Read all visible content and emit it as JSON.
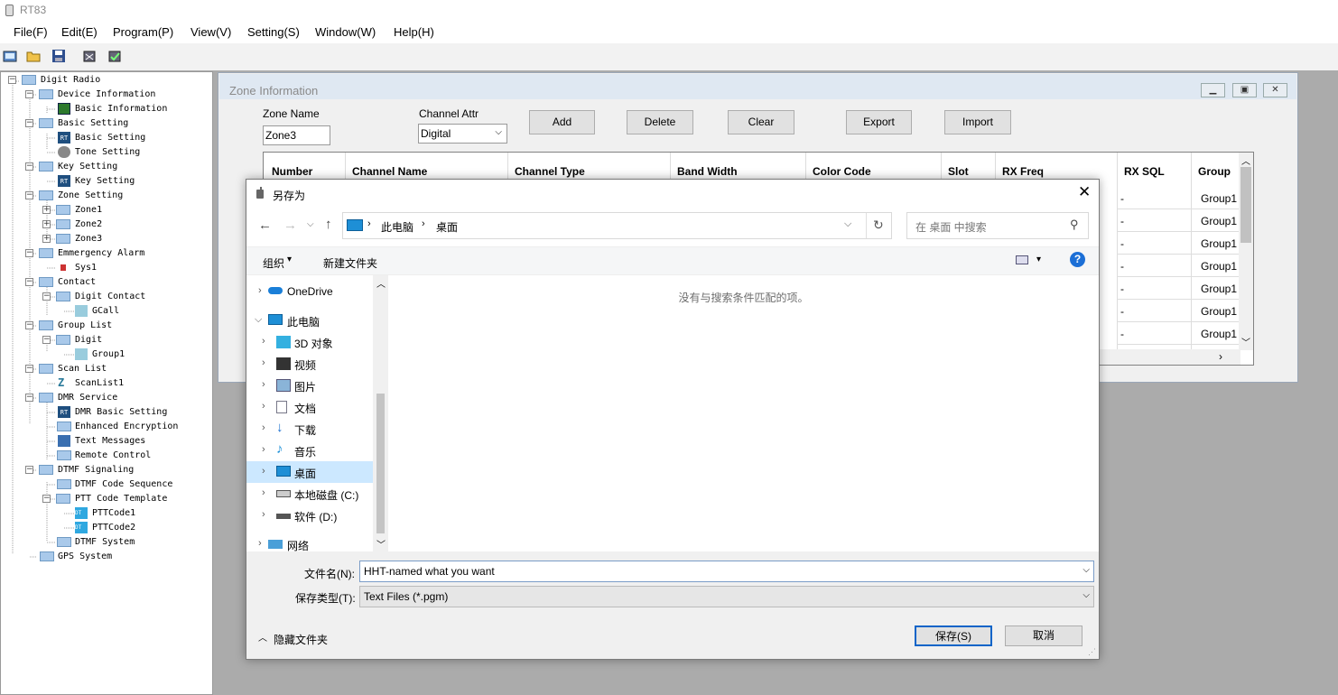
{
  "app": {
    "title": "RT83"
  },
  "menu": [
    "File(F)",
    "Edit(E)",
    "Program(P)",
    "View(V)",
    "Setting(S)",
    "Window(W)",
    "Help(H)"
  ],
  "tree": [
    "Digit Radio",
    "Device Information",
    "Basic Information",
    "Basic Setting",
    "Basic Setting",
    "Tone Setting",
    "Key Setting",
    "Key Setting",
    "Zone Setting",
    "Zone1",
    "Zone2",
    "Zone3",
    "Emmergency Alarm",
    "Sys1",
    "Contact",
    "Digit Contact",
    "GCall",
    "Group List",
    "Digit",
    "Group1",
    "Scan List",
    "ScanList1",
    "DMR Service",
    "DMR Basic Setting",
    "Enhanced Encryption",
    "Text Messages",
    "Remote Control",
    "DTMF Signaling",
    "DTMF Code Sequence",
    "PTT Code Template",
    "PTTCode1",
    "PTTCode2",
    "DTMF System",
    "GPS System"
  ],
  "zone": {
    "title": "Zone Information",
    "zone_name_label": "Zone Name",
    "zone_name_value": "Zone3",
    "channel_attr_label": "Channel Attr",
    "channel_attr_value": "Digital",
    "buttons": {
      "add": "Add",
      "delete": "Delete",
      "clear": "Clear",
      "export": "Export",
      "import": "Import"
    },
    "columns": [
      "Number",
      "Channel Name",
      "Channel Type",
      "Band Width",
      "Color Code",
      "Slot",
      "RX Freq",
      "RX SQL",
      "Group"
    ],
    "rows": [
      {
        "rx_sql": "-",
        "group": "Group1"
      },
      {
        "rx_sql": "-",
        "group": "Group1"
      },
      {
        "rx_sql": "-",
        "group": "Group1"
      },
      {
        "rx_sql": "-",
        "group": "Group1"
      },
      {
        "rx_sql": "-",
        "group": "Group1"
      },
      {
        "rx_sql": "-",
        "group": "Group1"
      },
      {
        "rx_sql": "-",
        "group": "Group1"
      }
    ]
  },
  "dialog": {
    "title": "另存为",
    "breadcrumb": [
      "此电脑",
      "桌面"
    ],
    "search_placeholder": "在 桌面 中搜索",
    "organize": "组织",
    "new_folder": "新建文件夹",
    "empty_message": "没有与搜索条件匹配的项。",
    "nav": [
      "OneDrive",
      "此电脑",
      "3D 对象",
      "视频",
      "图片",
      "文档",
      "下载",
      "音乐",
      "桌面",
      "本地磁盘 (C:)",
      "软件 (D:)",
      "网络"
    ],
    "filename_label": "文件名(N):",
    "filename_value": "HHT-named what you want",
    "filetype_label": "保存类型(T):",
    "filetype_value": "Text Files (*.pgm)",
    "hide_folders": "隐藏文件夹",
    "save": "保存(S)",
    "cancel": "取消"
  }
}
